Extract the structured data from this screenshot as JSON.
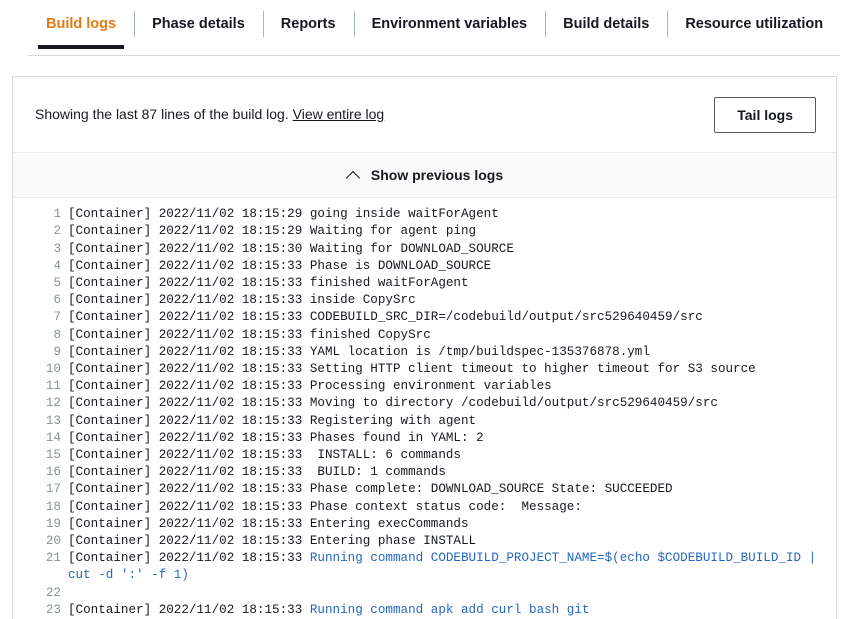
{
  "tabs": [
    {
      "label": "Build logs",
      "active": true
    },
    {
      "label": "Phase details",
      "active": false
    },
    {
      "label": "Reports",
      "active": false
    },
    {
      "label": "Environment variables",
      "active": false
    },
    {
      "label": "Build details",
      "active": false
    },
    {
      "label": "Resource utilization",
      "active": false
    }
  ],
  "header": {
    "summary_text": "Showing the last 87 lines of the build log.",
    "entire_log_link": "View entire log",
    "tail_logs_button": "Tail logs"
  },
  "show_previous": {
    "label": "Show previous logs",
    "icon": "chevron-up-icon"
  },
  "colors": {
    "active_tab": "#e47911",
    "command_blue": "#2567c0",
    "line_number": "#879596",
    "text": "#16191f",
    "border": "#d5dbdb"
  },
  "log": {
    "lines": [
      {
        "n": "1",
        "prefix": "[Container] 2022/11/02 18:15:29 going inside waitForAgent",
        "cmd": ""
      },
      {
        "n": "2",
        "prefix": "[Container] 2022/11/02 18:15:29 Waiting for agent ping",
        "cmd": ""
      },
      {
        "n": "3",
        "prefix": "[Container] 2022/11/02 18:15:30 Waiting for DOWNLOAD_SOURCE",
        "cmd": ""
      },
      {
        "n": "4",
        "prefix": "[Container] 2022/11/02 18:15:33 Phase is DOWNLOAD_SOURCE",
        "cmd": ""
      },
      {
        "n": "5",
        "prefix": "[Container] 2022/11/02 18:15:33 finished waitForAgent",
        "cmd": ""
      },
      {
        "n": "6",
        "prefix": "[Container] 2022/11/02 18:15:33 inside CopySrc",
        "cmd": ""
      },
      {
        "n": "7",
        "prefix": "[Container] 2022/11/02 18:15:33 CODEBUILD_SRC_DIR=/codebuild/output/src529640459/src",
        "cmd": ""
      },
      {
        "n": "8",
        "prefix": "[Container] 2022/11/02 18:15:33 finished CopySrc",
        "cmd": ""
      },
      {
        "n": "9",
        "prefix": "[Container] 2022/11/02 18:15:33 YAML location is /tmp/buildspec-135376878.yml",
        "cmd": ""
      },
      {
        "n": "10",
        "prefix": "[Container] 2022/11/02 18:15:33 Setting HTTP client timeout to higher timeout for S3 source",
        "cmd": ""
      },
      {
        "n": "11",
        "prefix": "[Container] 2022/11/02 18:15:33 Processing environment variables",
        "cmd": ""
      },
      {
        "n": "12",
        "prefix": "[Container] 2022/11/02 18:15:33 Moving to directory /codebuild/output/src529640459/src",
        "cmd": ""
      },
      {
        "n": "13",
        "prefix": "[Container] 2022/11/02 18:15:33 Registering with agent",
        "cmd": ""
      },
      {
        "n": "14",
        "prefix": "[Container] 2022/11/02 18:15:33 Phases found in YAML: 2",
        "cmd": ""
      },
      {
        "n": "15",
        "prefix": "[Container] 2022/11/02 18:15:33  INSTALL: 6 commands",
        "cmd": ""
      },
      {
        "n": "16",
        "prefix": "[Container] 2022/11/02 18:15:33  BUILD: 1 commands",
        "cmd": ""
      },
      {
        "n": "17",
        "prefix": "[Container] 2022/11/02 18:15:33 Phase complete: DOWNLOAD_SOURCE State: SUCCEEDED",
        "cmd": ""
      },
      {
        "n": "18",
        "prefix": "[Container] 2022/11/02 18:15:33 Phase context status code:  Message: ",
        "cmd": ""
      },
      {
        "n": "19",
        "prefix": "[Container] 2022/11/02 18:15:33 Entering execCommands",
        "cmd": ""
      },
      {
        "n": "20",
        "prefix": "[Container] 2022/11/02 18:15:33 Entering phase INSTALL",
        "cmd": ""
      },
      {
        "n": "21",
        "prefix": "[Container] 2022/11/02 18:15:33 ",
        "cmd": "Running command CODEBUILD_PROJECT_NAME=$(echo $CODEBUILD_BUILD_ID | cut -d ':' -f 1)"
      },
      {
        "n": "22",
        "prefix": "",
        "cmd": ""
      },
      {
        "n": "23",
        "prefix": "[Container] 2022/11/02 18:15:33 ",
        "cmd": "Running command apk add curl bash git"
      }
    ]
  }
}
